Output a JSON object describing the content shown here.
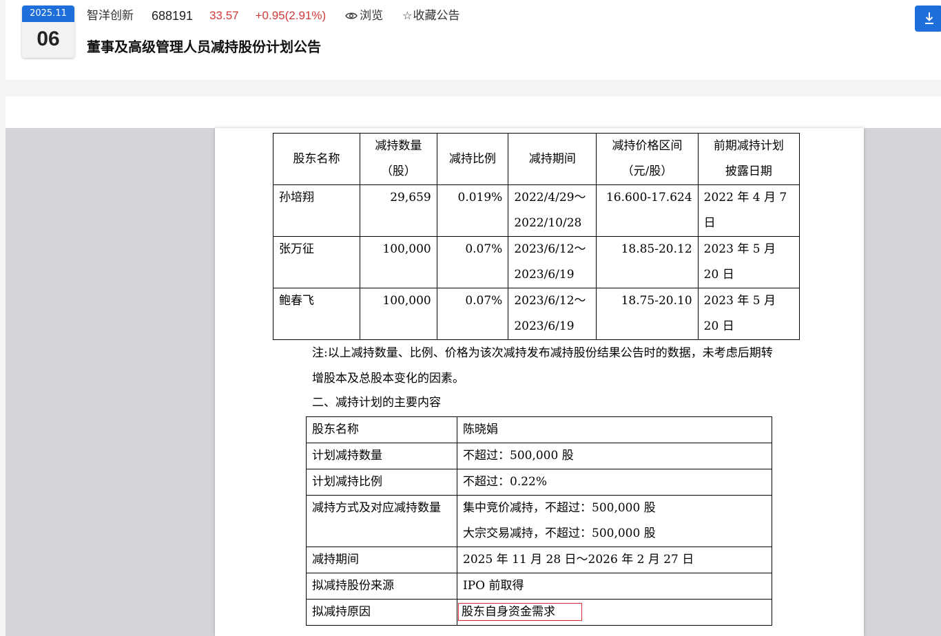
{
  "header": {
    "date_ym": "2025.11",
    "date_day": "06",
    "stock_name": "智洋创新",
    "stock_code": "688191",
    "price": "33.57",
    "change": "+0.95(2.91%)",
    "browse_label": "浏览",
    "favorite_label": "收藏公告",
    "title": "董事及高级管理人员减持股份计划公告",
    "accent_color": "#1e6fdc",
    "rise_color": "#d23a3a"
  },
  "prior_table": {
    "headers": [
      "股东名称",
      "减持数量（股）",
      "减持比例",
      "减持期间",
      "减持价格区间（元/股）",
      "前期减持计划披露日期"
    ],
    "rows": [
      [
        "孙培翔",
        "29,659",
        "0.019%",
        "2022/4/29～2022/10/28",
        "16.600-17.624",
        "2022 年 4 月 7 日"
      ],
      [
        "张万征",
        "100,000",
        "0.07%",
        "2023/6/12～2023/6/19",
        "18.85-20.12",
        "2023 年 5 月 20 日"
      ],
      [
        "鲍春飞",
        "100,000",
        "0.07%",
        "2023/6/12～2023/6/19",
        "18.75-20.10",
        "2023 年 5 月 20 日"
      ]
    ]
  },
  "note": "注:以上减持数量、比例、价格为该次减持发布减持股份结果公告时的数据，未考虑后期转增股本及总股本变化的因素。",
  "section_title": "二、减持计划的主要内容",
  "plan_table": [
    {
      "key": "股东名称",
      "value": "陈晓娟"
    },
    {
      "key": "计划减持数量",
      "value": "不超过：500,000 股"
    },
    {
      "key": "计划减持比例",
      "value": "不超过：0.22%"
    },
    {
      "key": "减持方式及对应减持数量",
      "value": "集中竞价减持，不超过：500,000 股",
      "value2": "大宗交易减持，不超过：500,000 股"
    },
    {
      "key": "减持期间",
      "value": "2025 年 11 月 28 日～2026 年 2 月 27 日"
    },
    {
      "key": "拟减持股份来源",
      "value": "IPO 前取得"
    },
    {
      "key": "拟减持原因",
      "value": "股东自身资金需求"
    }
  ]
}
